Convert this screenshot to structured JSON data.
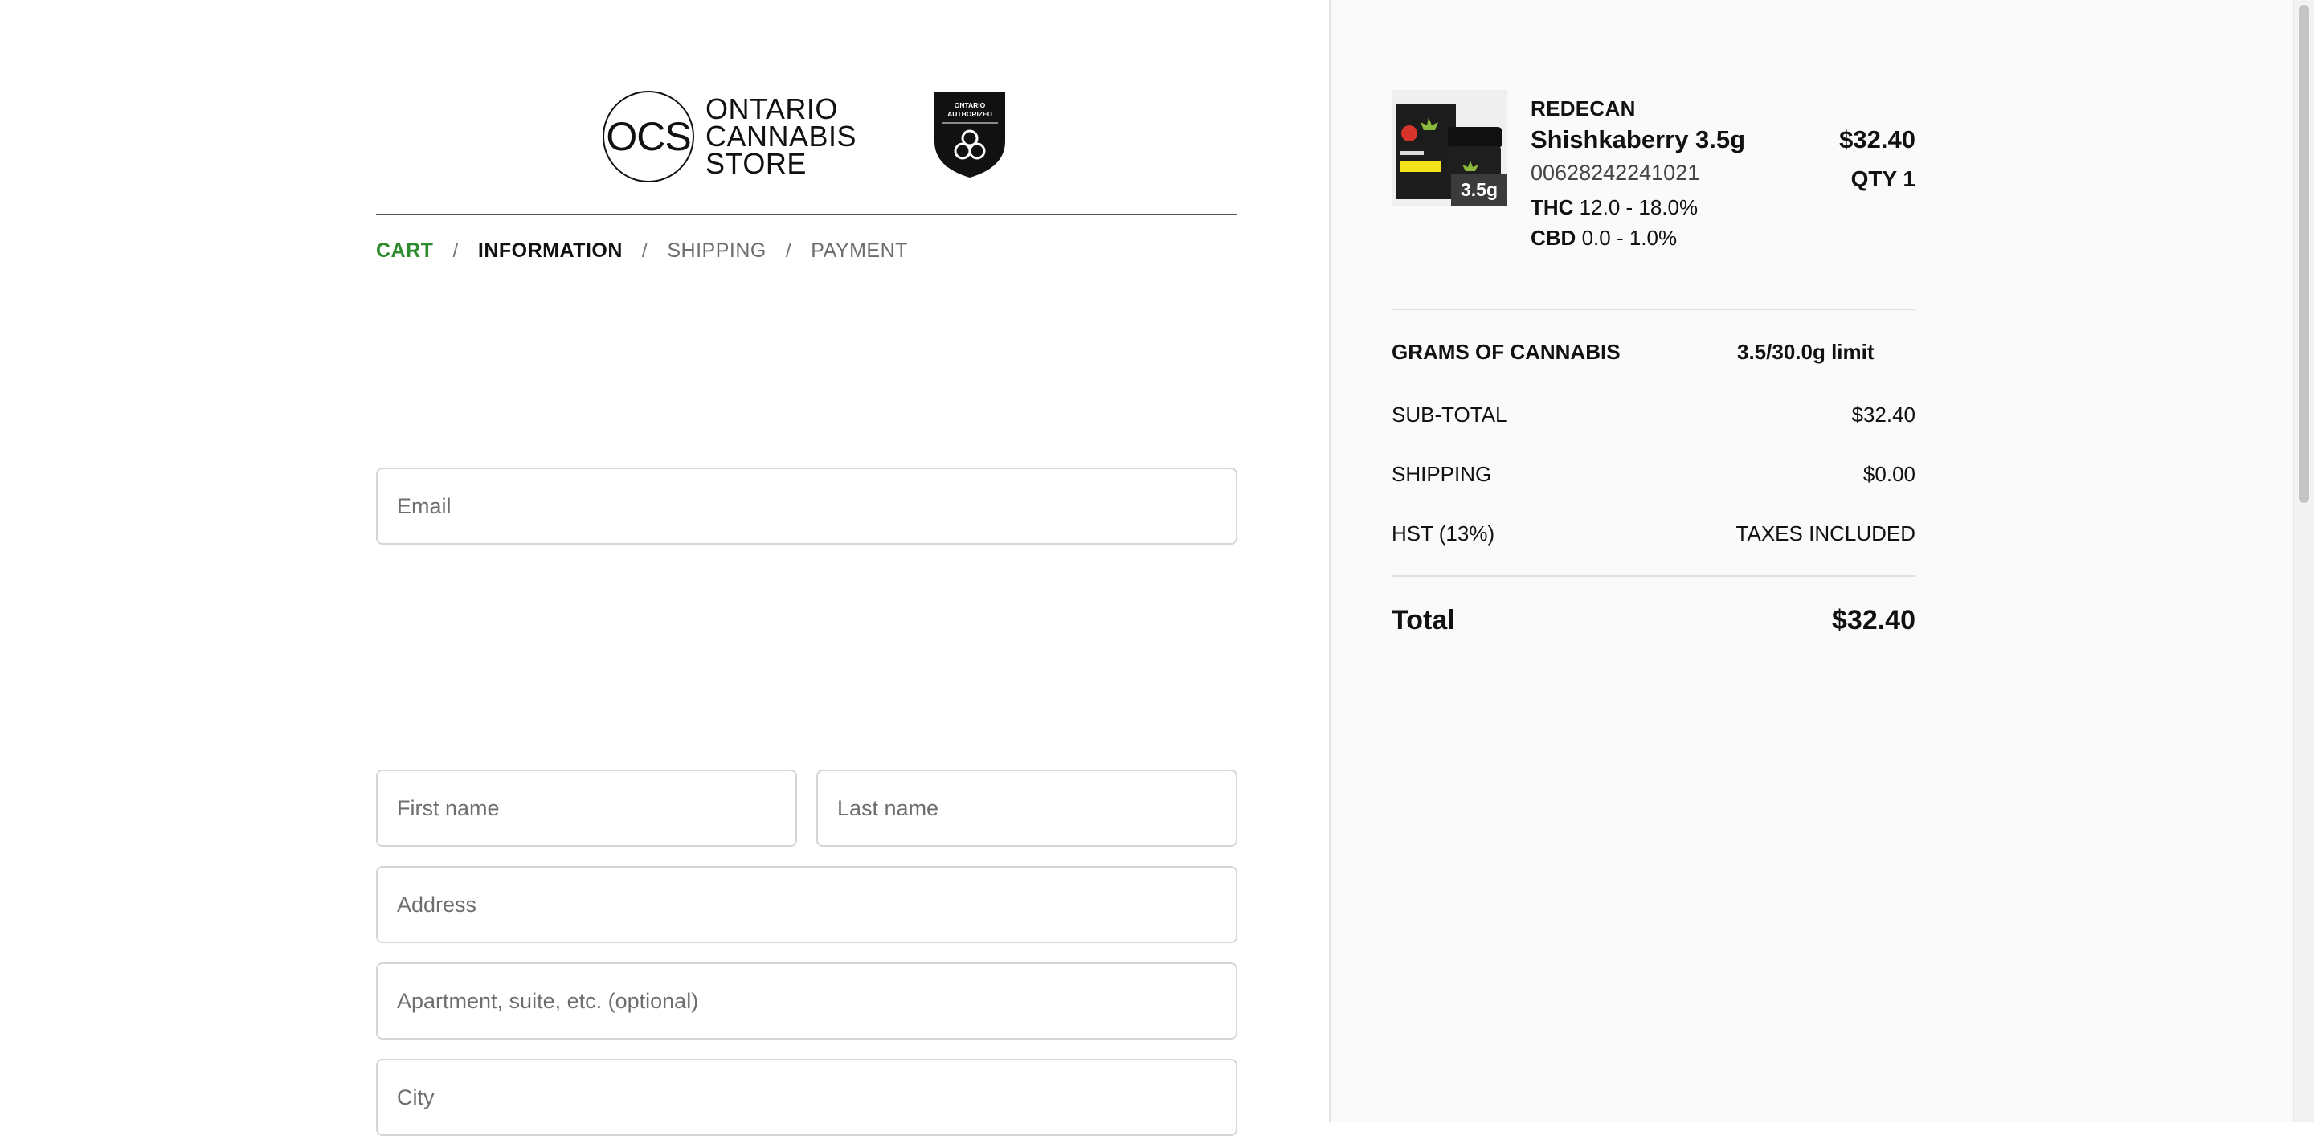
{
  "logo": {
    "initials": "OCS",
    "line1": "ONTARIO",
    "line2": "CANNABIS",
    "line3": "STORE",
    "badge_line1": "ONTARIO",
    "badge_line2": "AUTHORIZED"
  },
  "breadcrumb": {
    "cart": "CART",
    "separator": "/",
    "information": "INFORMATION",
    "shipping": "SHIPPING",
    "payment": "PAYMENT"
  },
  "form": {
    "email_placeholder": "Email",
    "first_name_placeholder": "First name",
    "last_name_placeholder": "Last name",
    "address_placeholder": "Address",
    "apartment_placeholder": "Apartment, suite, etc. (optional)",
    "city_placeholder": "City"
  },
  "summary": {
    "item": {
      "size_tag": "3.5g",
      "brand": "REDECAN",
      "name": "Shishkaberry 3.5g",
      "sku": "00628242241021",
      "thc_label": "THC",
      "thc_value": "12.0 - 18.0%",
      "cbd_label": "CBD",
      "cbd_value": "0.0 - 1.0%",
      "price": "$32.40",
      "qty": "QTY 1"
    },
    "grams_label": "GRAMS OF CANNABIS",
    "grams_value": "3.5/30.0g limit",
    "subtotal_label": "SUB-TOTAL",
    "subtotal_value": "$32.40",
    "shipping_label": "SHIPPING",
    "shipping_value": "$0.00",
    "hst_label": "HST (13%)",
    "hst_value": "TAXES INCLUDED",
    "total_label": "Total",
    "total_value": "$32.40"
  },
  "colors": {
    "accent_green": "#2e8b2e",
    "sidebar_bg": "#fafafa"
  }
}
